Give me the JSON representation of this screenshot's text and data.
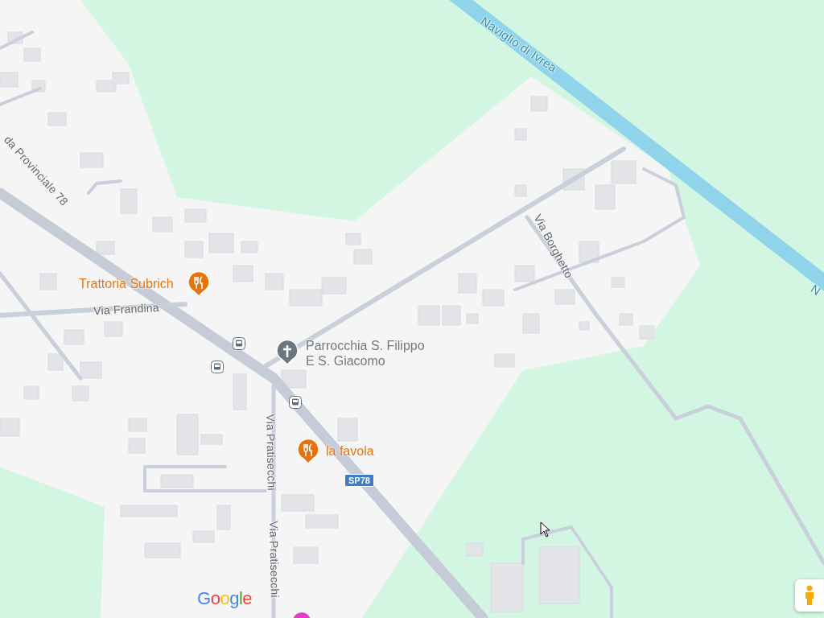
{
  "map": {
    "streets": [
      {
        "kind": "road",
        "text": "da Provinciale 78"
      },
      {
        "kind": "road",
        "text": "Via Frandina"
      },
      {
        "kind": "road",
        "text": "Via Borghetto"
      },
      {
        "kind": "road",
        "text": "Via Pratisecchi"
      },
      {
        "kind": "road",
        "text": "Via Pratisecchi"
      },
      {
        "kind": "water",
        "text": "Naviglio di Ivrea"
      },
      {
        "kind": "water",
        "text": "N"
      }
    ],
    "places": [
      {
        "kind": "restaurant",
        "name": "Trattoria Subrich"
      },
      {
        "kind": "church",
        "name": "Parrocchia S. Filippo\nE S. Giacomo"
      },
      {
        "kind": "restaurant",
        "name": "la favola"
      }
    ],
    "shields": [
      "SP78"
    ],
    "logo": "Google"
  }
}
